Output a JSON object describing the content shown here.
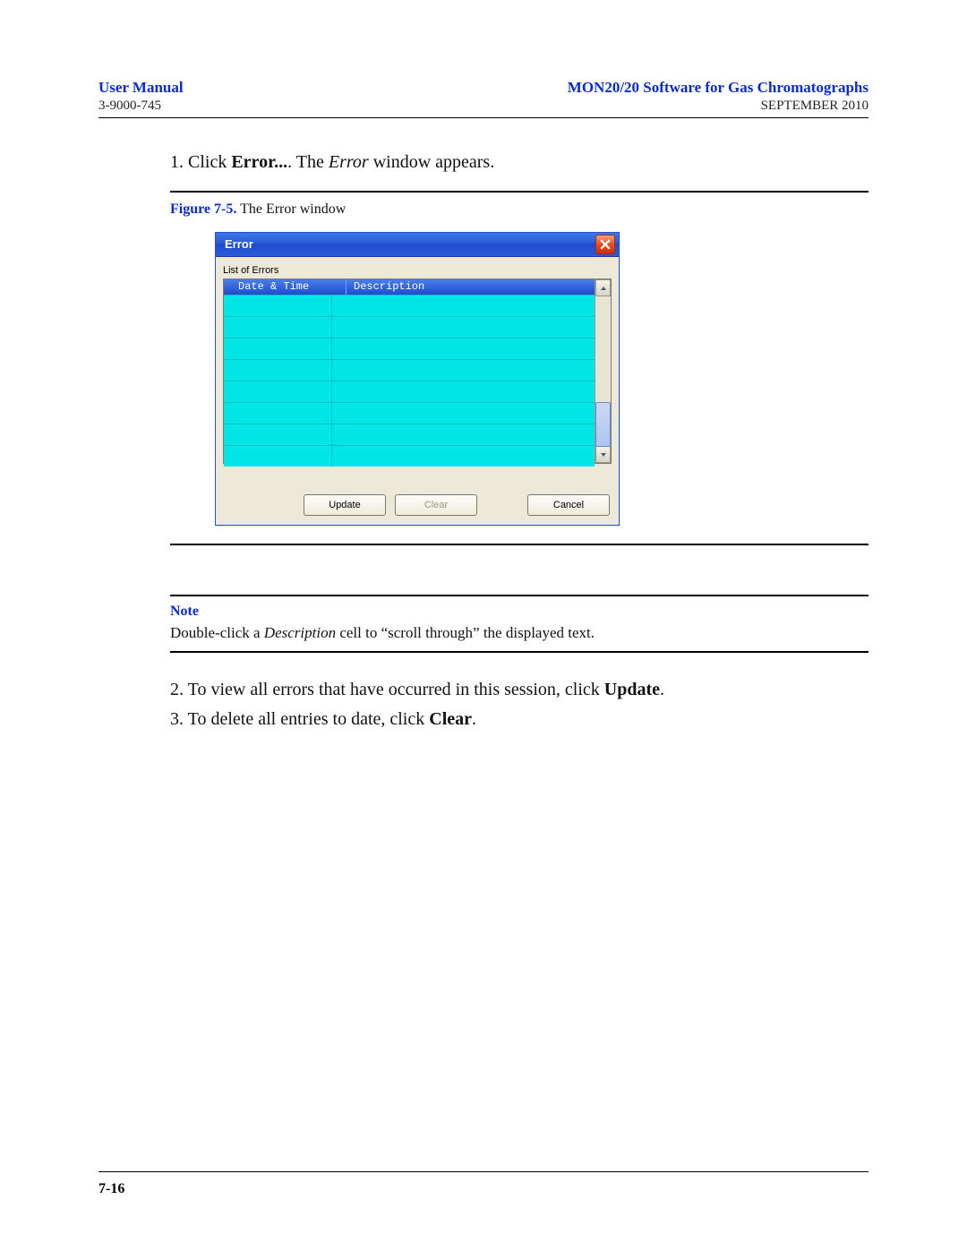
{
  "header": {
    "left_top": "User Manual",
    "right_top": "MON20/20 Software for Gas Chromatographs",
    "left_sub": "3-9000-745",
    "right_sub": "SEPTEMBER 2010"
  },
  "steps": {
    "s1_num": "1.",
    "s1_a": "Click ",
    "s1_b": "Error...",
    "s1_c": ". The ",
    "s1_d": "Error",
    "s1_e": " window appears.",
    "s2_num": "2.",
    "s2_a": "To view all errors that have occurred in this session, click ",
    "s2_b": "Update",
    "s2_c": ".",
    "s3_num": "3.",
    "s3_a": "To delete all entries to date, click ",
    "s3_b": "Clear",
    "s3_c": "."
  },
  "figure": {
    "label": "Figure 7-5.",
    "caption": "  The Error window"
  },
  "errorwin": {
    "title": "Error",
    "list_label": "List of Errors",
    "col_datetime": "Date & Time",
    "col_desc": "Description",
    "btn_update": "Update",
    "btn_clear": "Clear",
    "btn_cancel": "Cancel"
  },
  "note": {
    "label": "Note",
    "t1": "Double-click a ",
    "t2": "Description",
    "t3": " cell to “scroll through” the displayed text."
  },
  "footer": {
    "page": "7-16"
  }
}
